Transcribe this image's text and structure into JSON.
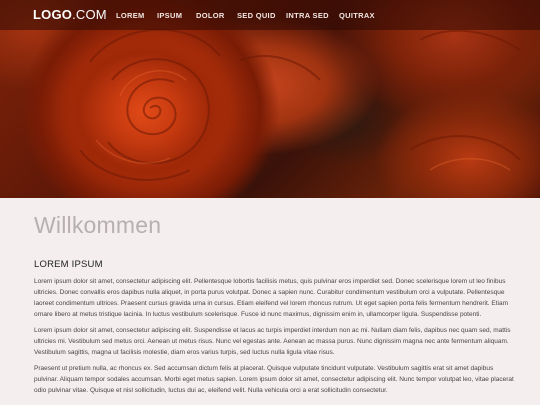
{
  "header": {
    "logo_bold": "LOGO",
    "logo_light": ".COM",
    "nav": [
      "LOREM",
      "IPSUM",
      "DOLOR",
      "SED QUID",
      "INTRA SED",
      "QUITRAX"
    ]
  },
  "main": {
    "title": "Willkommen",
    "section_heading": "LOREM IPSUM",
    "paragraphs": [
      "Lorem ipsum dolor sit amet, consectetur adipiscing elit. Pellentesque lobortis facilisis metus, quis pulvinar eros imperdiet sed. Donec scelerisque lorem ut leo finibus ultricies. Donec convallis eros dapibus nulla aliquet, in porta purus volutpat. Donec a sapien nunc. Curabitur condimentum vestibulum orci a vulputate. Pellentesque laoreet condimentum ultrices. Praesent cursus gravida urna in cursus. Etiam eleifend vel lorem rhoncus rutrum. Ut eget sapien porta felis fermentum hendrerit. Etiam ornare libero at metus tristique lacinia. In luctus vestibulum scelerisque. Fusce id nunc maximus, dignissim enim in, ullamcorper ligula. Suspendisse potenti.",
      "Lorem ipsum dolor sit amet, consectetur adipiscing elit. Suspendisse et lacus ac turpis imperdiet interdum non ac mi. Nullam diam felis, dapibus nec quam sed, mattis ultricies mi. Vestibulum sed metus orci. Aenean ut metus risus. Nunc vel egestas ante. Aenean ac massa purus. Nunc dignissim magna nec ante fermentum aliquam. Vestibulum sagittis, magna ut facilisis molestie, diam eros varius turpis, sed luctus nulla ligula vitae risus.",
      "Praesent ut pretium nulla, ac rhoncus ex. Sed accumsan dictum felis at placerat. Quisque vulputate tincidunt vulputate. Vestibulum sagittis erat sit amet dapibus pulvinar. Aliquam tempor sodales accumsan. Morbi eget metus sapien. Lorem ipsum dolor sit amet, consectetur adipiscing elit. Nunc tempor volutpat leo, vitae placerat odio pulvinar vitae. Quisque et nisl sollicitudin, luctus dui ac, eleifend velit. Nulla vehicula orci a erat sollicitudin consectetur."
    ]
  }
}
